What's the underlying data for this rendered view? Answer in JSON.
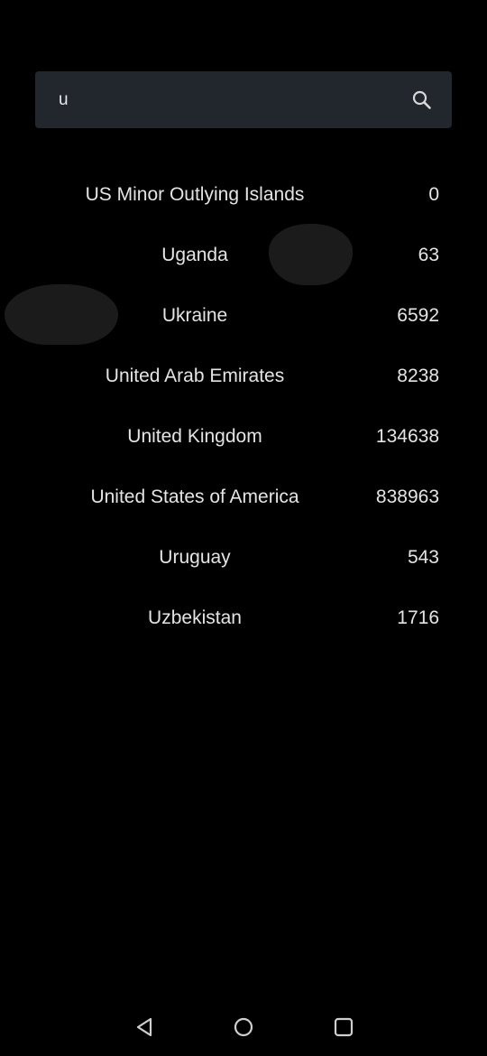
{
  "search": {
    "value": "u",
    "icon": "search-icon"
  },
  "results": [
    {
      "name": "US Minor Outlying Islands",
      "count": "0"
    },
    {
      "name": "Uganda",
      "count": "63"
    },
    {
      "name": "Ukraine",
      "count": "6592"
    },
    {
      "name": "United Arab Emirates",
      "count": "8238"
    },
    {
      "name": "United Kingdom",
      "count": "134638"
    },
    {
      "name": "United States of America",
      "count": "838963"
    },
    {
      "name": "Uruguay",
      "count": "543"
    },
    {
      "name": "Uzbekistan",
      "count": "1716"
    }
  ],
  "nav": {
    "back_icon": "back-triangle-icon",
    "home_icon": "home-circle-icon",
    "recent_icon": "recent-square-icon"
  },
  "colors": {
    "background": "#000000",
    "search_bar": "#22262d",
    "text": "#e4e4e4"
  }
}
